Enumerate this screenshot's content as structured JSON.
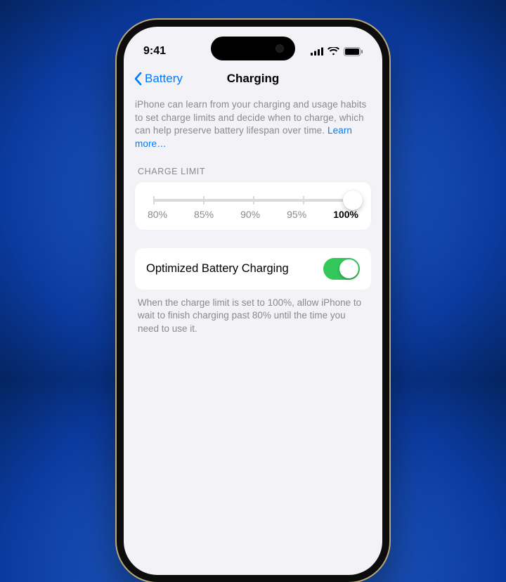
{
  "status": {
    "time": "9:41"
  },
  "nav": {
    "back": "Battery",
    "title": "Charging"
  },
  "intro": {
    "text": "iPhone can learn from your charging and usage habits to set charge limits and decide when to charge, which can help preserve battery lifespan over time. ",
    "link": "Learn more…"
  },
  "chargeLimit": {
    "header": "CHARGE LIMIT",
    "stops": [
      "80%",
      "85%",
      "90%",
      "95%",
      "100%"
    ],
    "selectedIndex": 4
  },
  "optimized": {
    "label": "Optimized Battery Charging",
    "enabled": true,
    "footer": "When the charge limit is set to 100%, allow iPhone to wait to finish charging past 80% until the time you need to use it."
  }
}
